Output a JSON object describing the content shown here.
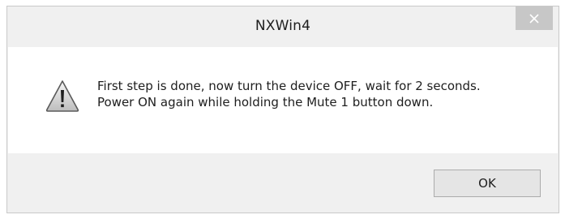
{
  "window": {
    "title": "NXWin4",
    "close_icon": "close-icon"
  },
  "message": {
    "icon": "warning-icon",
    "line1": "First step is done, now turn the device OFF, wait for 2 seconds.",
    "line2": "Power ON again while holding the Mute 1 button down."
  },
  "buttons": {
    "ok_label": "OK"
  },
  "colors": {
    "close_bg": "#c7c7c7",
    "warning_fill": "#f2c200"
  }
}
